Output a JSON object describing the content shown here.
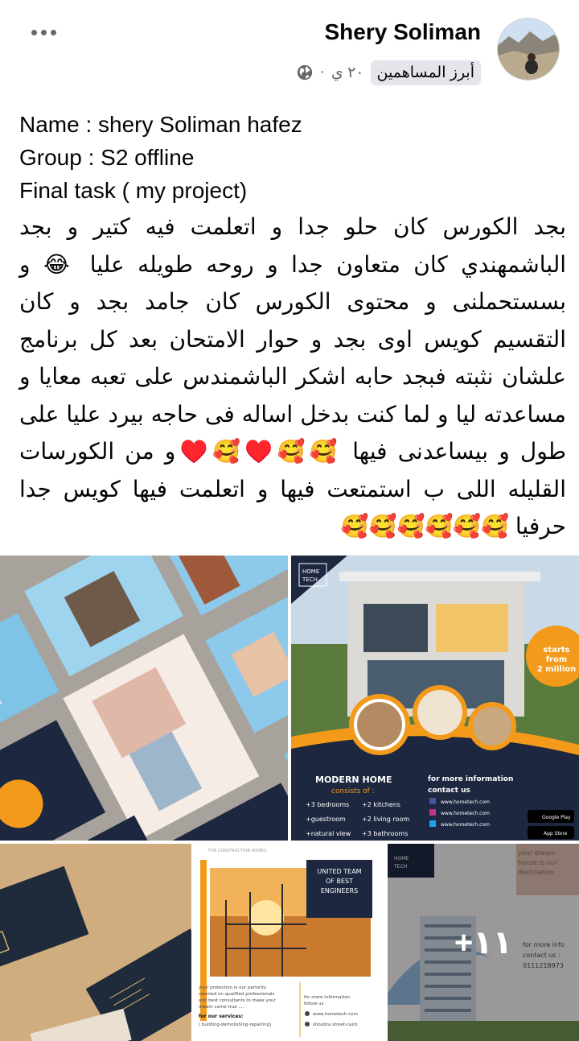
{
  "header": {
    "author_name": "Shery Soliman",
    "badge": "أبرز المساهمين",
    "time": "٢٠ ي"
  },
  "post": {
    "line1": "Name : shery Soliman hafez",
    "line2": "Group : S2 offline",
    "line3": "Final task ( my project)",
    "body_part1": "بجد الكورس كان حلو جدا و اتعلمت فيه كتير و بجد الباشمهندي كان متعاون جدا و روحه طويله عليا ",
    "emoji1": "😂",
    "body_part2": " و بسستحملنى و محتوى الكورس كان جامد بجد و كان التقسيم كويس اوى بجد و حوار الامتحان بعد كل برنامج علشان نثبته فبجد حابه اشكر الباشمندس على تعبه معايا و مساعدته ليا و لما كنت بدخل اساله فى حاجه بيرد عليا على طول و بيساعدنى فيها ",
    "emoji2": "🥰🥰♥️🥰♥️",
    "body_part3": "و من الكورسات القليله اللى ب استمتعت فيها و اتعلمت فيها كويس جدا حرفيا ",
    "emoji3": "🥰🥰🥰🥰🥰🥰"
  },
  "photos": {
    "more_count": "+١١",
    "poster2": {
      "brand": "HOME TECH",
      "starts": "starts",
      "from": "from",
      "price": "2 miilion",
      "modern_home": "MODERN HOME",
      "consists_of": "consists of :",
      "features": [
        "+3 bedrooms",
        "+2 kitchens",
        "+guestroom",
        "+2 living room",
        "+natural view",
        "+3 bathrooms"
      ],
      "more_info": "for more information",
      "contact_us": "contact us",
      "links": [
        "www.hometech.com",
        "www.hometech.com",
        "www.hometech.com"
      ],
      "google_play": "Google Play",
      "app_store": "App Store"
    },
    "poster4": {
      "top_label": "FOR CONSTRUCTION WORKS",
      "team_line1": "UNITED TEAM",
      "team_line2": "OF BEST",
      "team_line3": "ENGINEERS",
      "protection": "your protection is our periority",
      "counted": "counted on qualified professionals",
      "consultants": "and best consultants to make your",
      "dream": "dream come true ....",
      "services": "for our services:",
      "services_list": "( building-demolishing-repairing)",
      "more_info": "for more information",
      "follow": "follow us",
      "site": "www.hometech.com",
      "address": "shoubra street-cairo"
    },
    "poster5": {
      "brand": "HOME TECH",
      "tag1": "your dream",
      "tag2": "house is our",
      "tag3": "destination",
      "more_info": "for more info",
      "contact": "contact us :",
      "phone": "0111218973"
    }
  },
  "colors": {
    "text": "#050505",
    "muted": "#65676b",
    "badge_bg": "#e4e6eb",
    "orange": "#f39a1b",
    "navy": "#1d2740"
  },
  "icons": {
    "more": "three-dots-icon",
    "audience": "globe-icon"
  }
}
